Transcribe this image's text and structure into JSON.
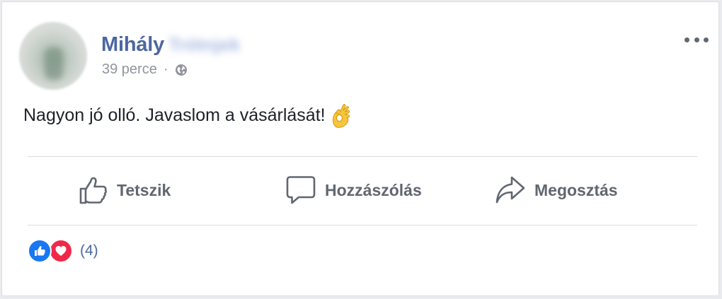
{
  "post": {
    "author_first_name": "Mihály",
    "author_last_name_blurred": "Trótnjek",
    "timestamp": "39 perce",
    "separator": "·",
    "privacy_icon": "globe-icon",
    "body_text": "Nagyon jó olló. Javaslom a vásárlását!",
    "emoji": "ok-hand-emoji",
    "menu_icon": "more-horizontal-icon"
  },
  "actions": {
    "like_label": "Tetszik",
    "comment_label": "Hozzászólás",
    "share_label": "Megosztás"
  },
  "reactions": {
    "types": [
      "like",
      "love"
    ],
    "count_text": "(4)"
  },
  "colors": {
    "author_name": "#4b67a1",
    "meta_text": "#90949c",
    "action_text": "#606770",
    "like_blue": "#1877f2",
    "love_red": "#f0284a",
    "divider": "#dadde1"
  }
}
